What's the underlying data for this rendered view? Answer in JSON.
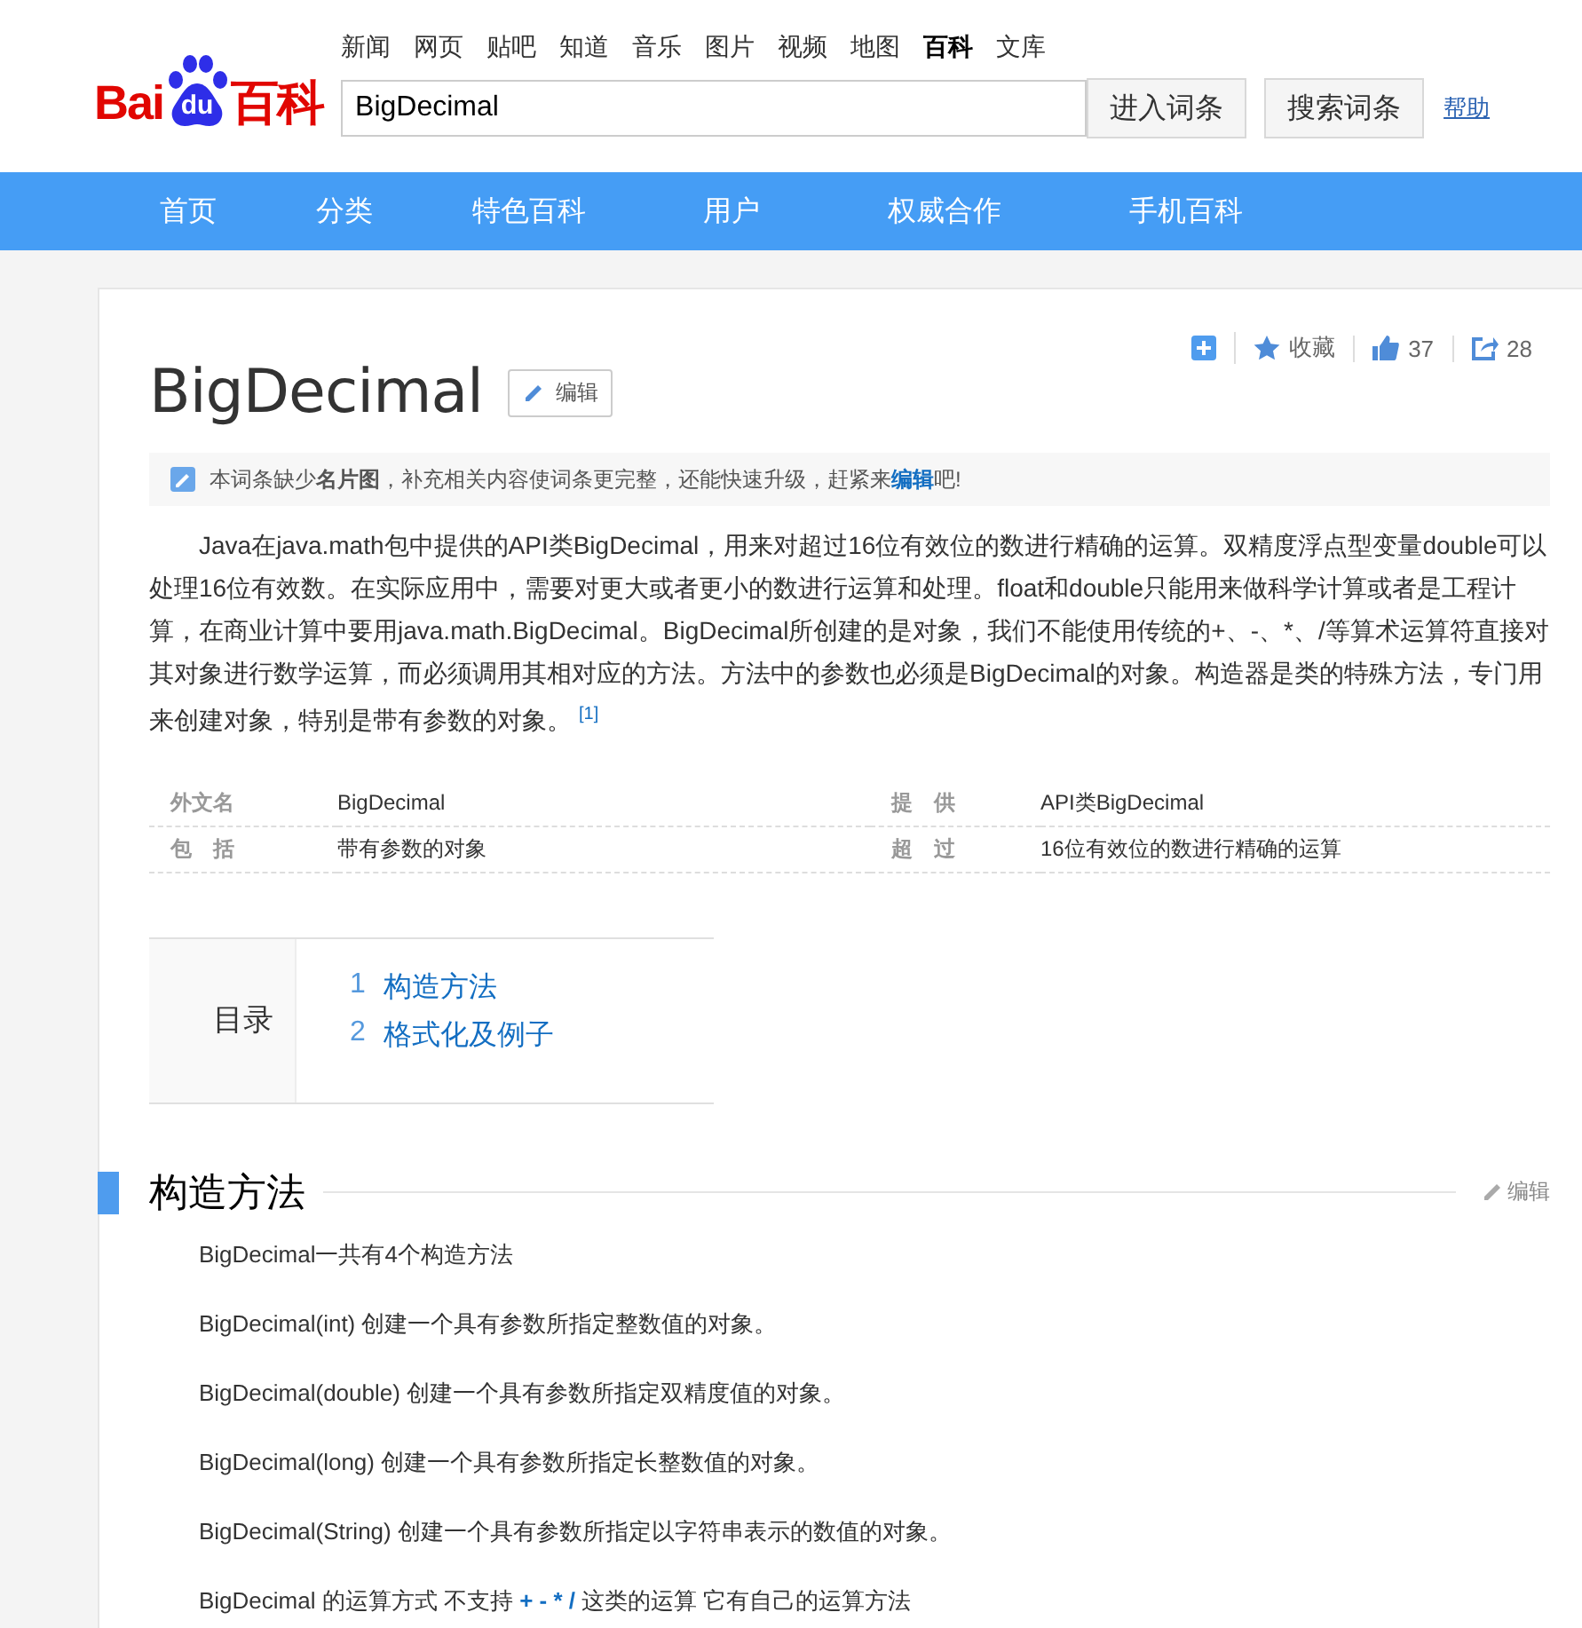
{
  "header": {
    "logo": {
      "left": "Bai",
      "paw": "du",
      "right": "百科"
    },
    "top_links": [
      {
        "label": "新闻",
        "selected": false
      },
      {
        "label": "网页",
        "selected": false
      },
      {
        "label": "贴吧",
        "selected": false
      },
      {
        "label": "知道",
        "selected": false
      },
      {
        "label": "音乐",
        "selected": false
      },
      {
        "label": "图片",
        "selected": false
      },
      {
        "label": "视频",
        "selected": false
      },
      {
        "label": "地图",
        "selected": false
      },
      {
        "label": "百科",
        "selected": true
      },
      {
        "label": "文库",
        "selected": false
      }
    ],
    "search": {
      "value": "BigDecimal"
    },
    "buttons": [
      "进入词条",
      "搜索词条"
    ],
    "help": "帮助"
  },
  "nav": [
    "首页",
    "分类",
    "特色百科",
    "用户",
    "权威合作",
    "手机百科"
  ],
  "article": {
    "actions": {
      "favorite": "收藏",
      "likes": "37",
      "shares": "28"
    },
    "title": "BigDecimal",
    "edit": "编辑",
    "notice": "本词条缺少**名片图**，补充相关内容使词条更完整，还能快速升级，赶紧来",
    "notice_link": "编辑",
    "notice_end": "吧!",
    "summary": "Java在java.math包中提供的API类BigDecimal，用来对超过16位有效位的数进行精确的运算。双精度浮点型变量double可以处理16位有效数。在实际应用中，需要对更大或者更小的数进行运算和处理。float和double只能用来做科学计算或者是工程计算，在商业计算中要用java.math.BigDecimal。BigDecimal所创建的是对象，我们不能使用传统的+、-、*、/等算术运算符直接对其对象进行数学运算，而必须调用其相对应的方法。方法中的参数也必须是BigDecimal的对象。构造器是类的特殊方法，专门用来创建对象，特别是带有参数的对象。",
    "reference": "[1]",
    "basic_info": [
      {
        "name": "外文名",
        "value": "BigDecimal"
      },
      {
        "name": "提　供",
        "value": "API类BigDecimal"
      },
      {
        "name": "包　括",
        "value": "带有参数的对象"
      },
      {
        "name": "超　过",
        "value": "16位有效位的数进行精确的运算"
      }
    ],
    "toc": {
      "title": "目录",
      "items": [
        {
          "number": "1",
          "title": "构造方法"
        },
        {
          "number": "2",
          "title": "格式化及例子"
        }
      ]
    },
    "section": {
      "title": "构造方法",
      "edit": "编辑",
      "paragraphs": [
        "BigDecimal一共有4个构造方法",
        "BigDecimal(int) 创建一个具有参数所指定整数值的对象。",
        "BigDecimal(double) 创建一个具有参数所指定双精度值的对象。",
        "BigDecimal(long) 创建一个具有参数所指定长整数值的对象。",
        "BigDecimal(String) 创建一个具有参数所指定以字符串表示的数值的对象。",
        "BigDecimal 的运算方式 不支持 **+ - * /** 这类的运算 它有自己的运算方法"
      ]
    }
  }
}
